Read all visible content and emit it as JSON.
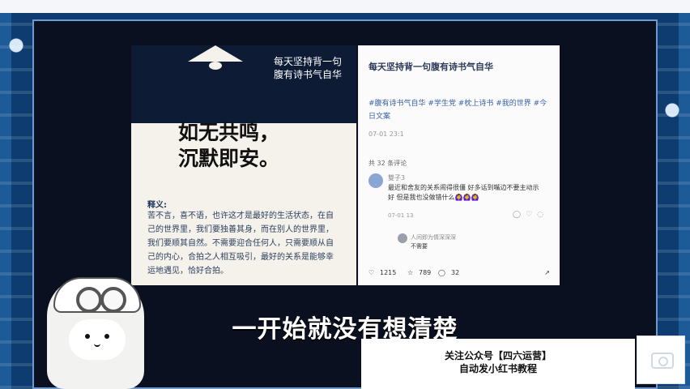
{
  "image": {
    "subtitle": "每天坚持背一句\n腹有诗书气自华",
    "headline": "如无共鸣，\n沉默即安。",
    "explanation_label": "释义:",
    "explanation_text": "苦不言，喜不语，也许这才是最好的生活状态，在自己的世界里，我们要独善其身，而在别人的世界里，我们要顺其自然。不需要迎合任何人，只需要顺从自己的内心，合拍之人相互吸引，最好的关系是能够幸运地遇见，恰好合拍。"
  },
  "post": {
    "title": "每天坚持背一句腹有诗书气自华",
    "tags": "#腹有诗书气自华 #学生党 #枕上诗书 #我的世界 #今日文案",
    "date": "07-01 23:1",
    "comment_count": "共 32 条评论",
    "comment": {
      "name": "雙子3",
      "text": "最近和舍友的关系闹得很僵 好多话到嘴边不要主动示好 但是我也没做错什么🙆‍♀️🙆‍♀️🙆‍♀️",
      "meta": "07-01 13",
      "reply_name": "人间即为情深深深",
      "reply_text": "不需要"
    },
    "actions": {
      "likes": "1215",
      "stars": "789",
      "comments": "32"
    }
  },
  "overlay": {
    "subtitle": "一开始就没有想清楚",
    "promo_line1": "关注公众号【四六运营】",
    "promo_line2": "自动发小红书教程"
  }
}
